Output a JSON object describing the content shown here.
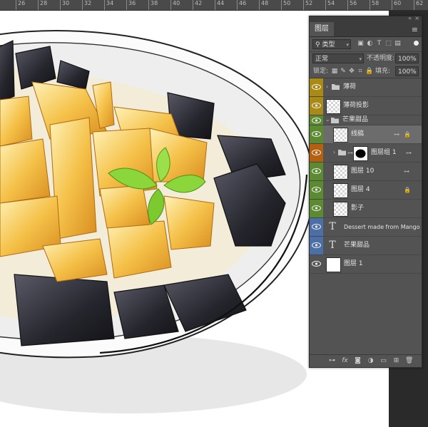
{
  "ruler": {
    "ticks": [
      "26",
      "28",
      "30",
      "32",
      "34",
      "36",
      "38",
      "40",
      "42",
      "44",
      "46",
      "48",
      "50",
      "52",
      "54",
      "56",
      "58",
      "60",
      "62"
    ]
  },
  "panel": {
    "tab_label": "图层",
    "filter_select": "类型",
    "blend_mode": "正常",
    "opacity_label": "不透明度:",
    "opacity_value": "100%",
    "lock_label": "锁定:",
    "fill_label": "填充:",
    "fill_value": "100%"
  },
  "colors": {
    "tag_yellow": "#a88a14",
    "tag_green": "#5b8a30",
    "tag_orange": "#b5600f",
    "tag_blue": "#4b6fa6",
    "tag_none": "#535353"
  },
  "layers": [
    {
      "name": "薄荷",
      "kind": "group"
    },
    {
      "name": "薄荷投影",
      "kind": "raster"
    },
    {
      "name": "芒果甜品",
      "kind": "group"
    },
    {
      "name": "线稿",
      "kind": "raster"
    },
    {
      "name": "图层组 1",
      "kind": "group-masked"
    },
    {
      "name": "图层 10",
      "kind": "raster"
    },
    {
      "name": "图层 4",
      "kind": "raster"
    },
    {
      "name": "影子",
      "kind": "raster"
    },
    {
      "name": "Dessert made from Mango",
      "kind": "text"
    },
    {
      "name": "芒果甜品",
      "kind": "text"
    },
    {
      "name": "图层 1",
      "kind": "fill"
    }
  ],
  "icons": {
    "menu": "panel-menu-icon",
    "visibility": "eye-icon",
    "link": "link-icon",
    "lock": "lock-icon"
  }
}
